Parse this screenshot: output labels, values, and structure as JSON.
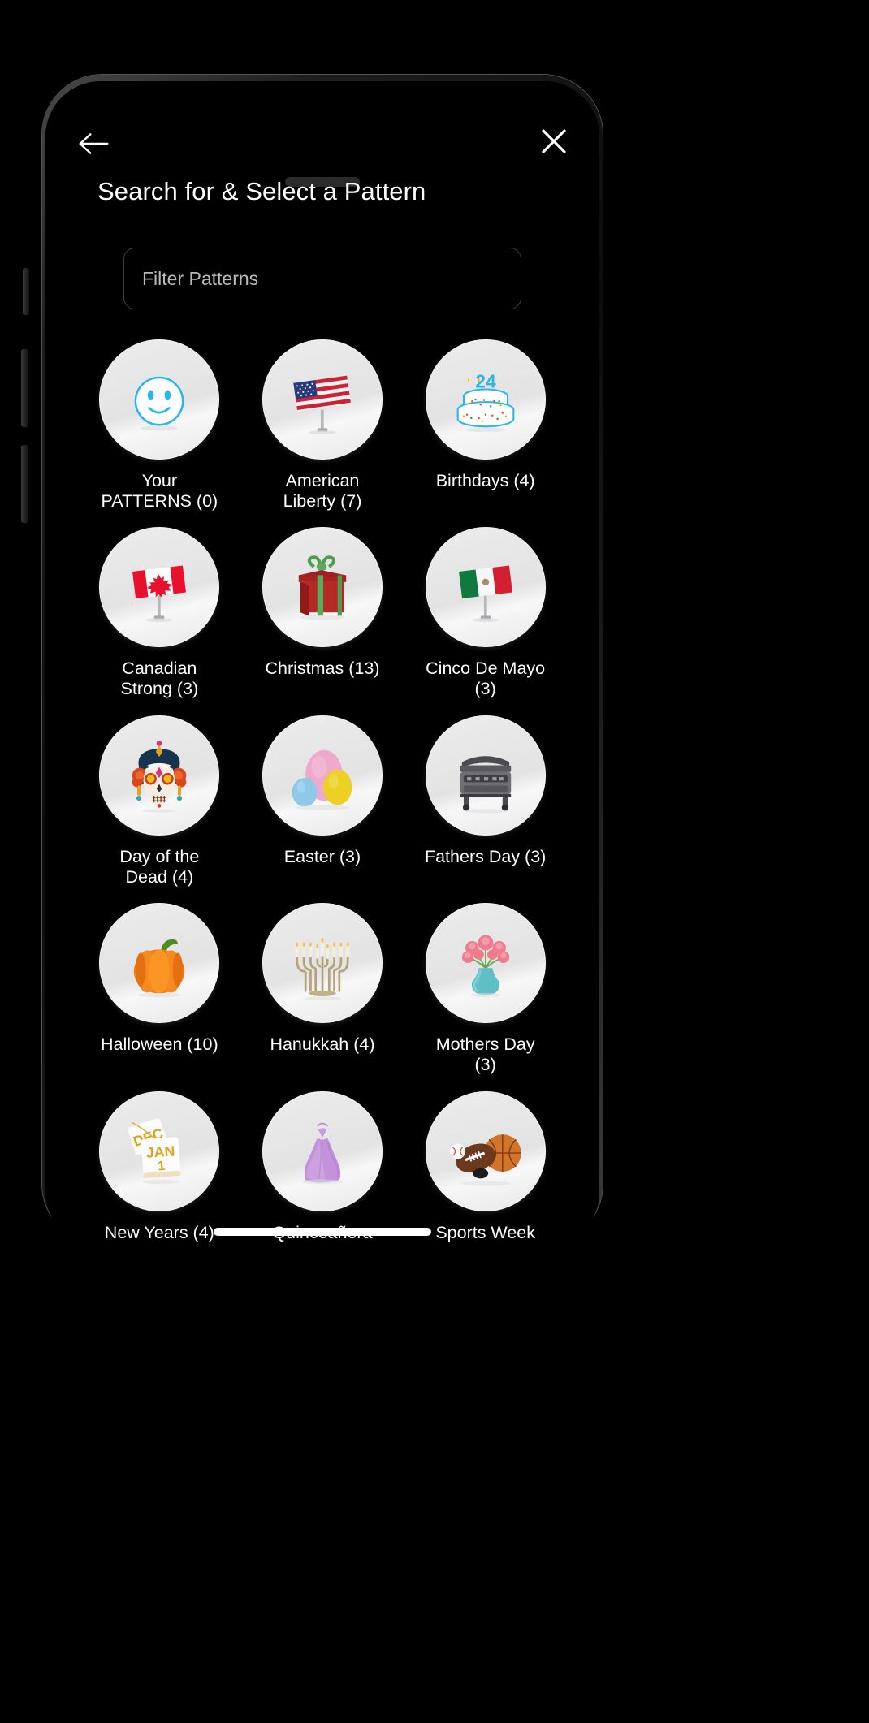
{
  "header": {
    "title": "Search for & Select a Pattern",
    "back_icon": "arrow-left-icon",
    "close_icon": "close-icon"
  },
  "search": {
    "placeholder": "Filter Patterns",
    "value": ""
  },
  "colors": {
    "background": "#000000",
    "tile_background": "#e9e9ea",
    "text": "#ffffff",
    "input_border": "#3d3d3d",
    "accent_cyan": "#29b6e8"
  },
  "patterns": [
    {
      "label": "Your PATTERNS (0)",
      "name": "Your PATTERNS",
      "count": 0,
      "icon": "smiley-face-icon"
    },
    {
      "label": "American Liberty (7)",
      "name": "American Liberty",
      "count": 7,
      "icon": "usa-flag-icon"
    },
    {
      "label": "Birthdays (4)",
      "name": "Birthdays",
      "count": 4,
      "icon": "birthday-cake-icon"
    },
    {
      "label": "Canadian Strong (3)",
      "name": "Canadian Strong",
      "count": 3,
      "icon": "canada-flag-icon"
    },
    {
      "label": "Christmas (13)",
      "name": "Christmas",
      "count": 13,
      "icon": "gift-box-icon"
    },
    {
      "label": "Cinco De Mayo (3)",
      "name": "Cinco De Mayo",
      "count": 3,
      "icon": "mexico-flag-icon"
    },
    {
      "label": "Day of the Dead (4)",
      "name": "Day of the Dead",
      "count": 4,
      "icon": "sugar-skull-icon"
    },
    {
      "label": "Easter (3)",
      "name": "Easter",
      "count": 3,
      "icon": "easter-eggs-icon"
    },
    {
      "label": "Fathers Day (3)",
      "name": "Fathers Day",
      "count": 3,
      "icon": "bbq-grill-icon"
    },
    {
      "label": "Halloween (10)",
      "name": "Halloween",
      "count": 10,
      "icon": "pumpkin-icon"
    },
    {
      "label": "Hanukkah (4)",
      "name": "Hanukkah",
      "count": 4,
      "icon": "menorah-icon"
    },
    {
      "label": "Mothers Day (3)",
      "name": "Mothers Day",
      "count": 3,
      "icon": "flower-vase-icon"
    },
    {
      "label": "New Years (4)",
      "name": "New Years",
      "count": 4,
      "icon": "calendar-jan1-icon"
    },
    {
      "label": "Quinceañera",
      "name": "Quinceañera",
      "count": null,
      "icon": "ball-gown-icon"
    },
    {
      "label": "Sports Week",
      "name": "Sports Week",
      "count": null,
      "icon": "sports-balls-icon"
    }
  ],
  "calendar_icon_text": {
    "top": "DEC",
    "month": "JAN",
    "day": "1"
  },
  "cake_icon_text": {
    "number": "24"
  }
}
